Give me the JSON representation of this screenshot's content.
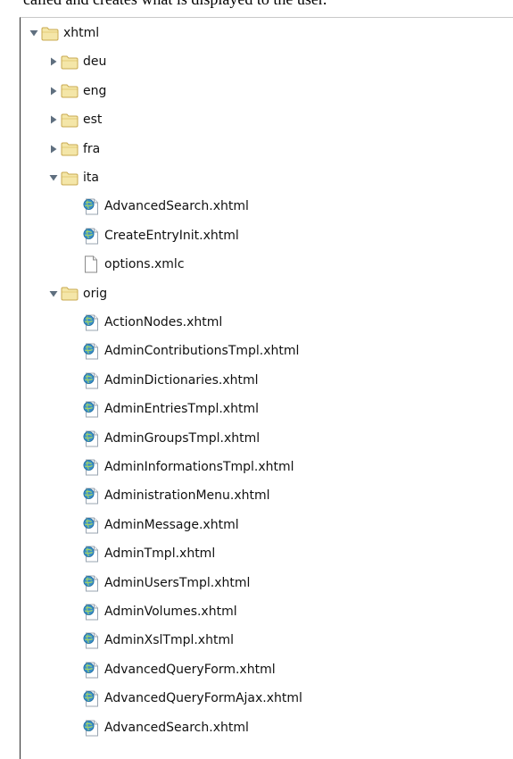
{
  "caption": "called and creates what is displayed to the user.",
  "tree": [
    {
      "label": "xhtml",
      "type": "folder",
      "level": 0,
      "state": "expanded"
    },
    {
      "label": "deu",
      "type": "folder",
      "level": 1,
      "state": "collapsed"
    },
    {
      "label": "eng",
      "type": "folder",
      "level": 1,
      "state": "collapsed"
    },
    {
      "label": "est",
      "type": "folder",
      "level": 1,
      "state": "collapsed"
    },
    {
      "label": "fra",
      "type": "folder",
      "level": 1,
      "state": "collapsed"
    },
    {
      "label": "ita",
      "type": "folder",
      "level": 1,
      "state": "expanded"
    },
    {
      "label": "AdvancedSearch.xhtml",
      "type": "xhtml",
      "level": 2
    },
    {
      "label": "CreateEntryInit.xhtml",
      "type": "xhtml",
      "level": 2
    },
    {
      "label": "options.xmlc",
      "type": "file",
      "level": 2
    },
    {
      "label": "orig",
      "type": "folder",
      "level": 1,
      "state": "expanded"
    },
    {
      "label": "ActionNodes.xhtml",
      "type": "xhtml",
      "level": 2
    },
    {
      "label": "AdminContributionsTmpl.xhtml",
      "type": "xhtml",
      "level": 2
    },
    {
      "label": "AdminDictionaries.xhtml",
      "type": "xhtml",
      "level": 2
    },
    {
      "label": "AdminEntriesTmpl.xhtml",
      "type": "xhtml",
      "level": 2
    },
    {
      "label": "AdminGroupsTmpl.xhtml",
      "type": "xhtml",
      "level": 2
    },
    {
      "label": "AdminInformationsTmpl.xhtml",
      "type": "xhtml",
      "level": 2
    },
    {
      "label": "AdministrationMenu.xhtml",
      "type": "xhtml",
      "level": 2
    },
    {
      "label": "AdminMessage.xhtml",
      "type": "xhtml",
      "level": 2
    },
    {
      "label": "AdminTmpl.xhtml",
      "type": "xhtml",
      "level": 2
    },
    {
      "label": "AdminUsersTmpl.xhtml",
      "type": "xhtml",
      "level": 2
    },
    {
      "label": "AdminVolumes.xhtml",
      "type": "xhtml",
      "level": 2
    },
    {
      "label": "AdminXslTmpl.xhtml",
      "type": "xhtml",
      "level": 2
    },
    {
      "label": "AdvancedQueryForm.xhtml",
      "type": "xhtml",
      "level": 2
    },
    {
      "label": "AdvancedQueryFormAjax.xhtml",
      "type": "xhtml",
      "level": 2
    },
    {
      "label": "AdvancedSearch.xhtml",
      "type": "xhtml",
      "level": 2
    }
  ]
}
